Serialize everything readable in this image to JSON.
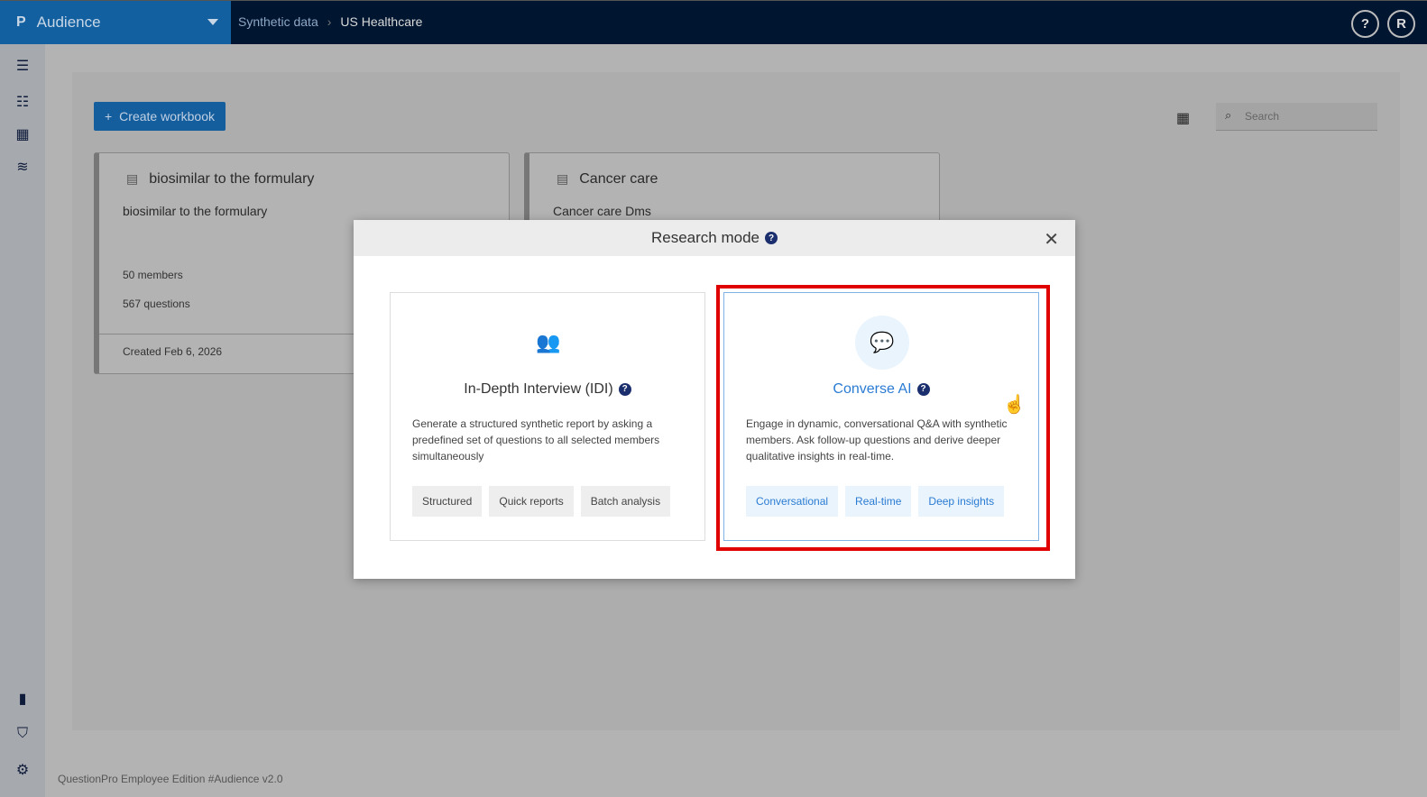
{
  "app": {
    "logo": "P",
    "name": "Audience"
  },
  "breadcrumb": [
    "Synthetic data",
    "US Healthcare"
  ],
  "header": {
    "help": "?",
    "avatar": "R"
  },
  "toolbar": {
    "create_label": "Create workbook",
    "search_placeholder": "Search"
  },
  "cards": [
    {
      "title": "biosimilar to the formulary",
      "description": "biosimilar to the formulary",
      "members": "50 members",
      "questions": "567 questions",
      "created": "Created Feb 6, 2026"
    },
    {
      "title": "Cancer care",
      "description": "Cancer care Dms"
    }
  ],
  "modal": {
    "title": "Research mode",
    "options": [
      {
        "title": "In-Depth Interview (IDI)",
        "description": "Generate a structured synthetic report by asking a predefined set of questions to all selected members simultaneously",
        "tags": [
          "Structured",
          "Quick reports",
          "Batch analysis"
        ],
        "icon": "users-icon"
      },
      {
        "title": "Converse AI",
        "description": "Engage in dynamic, conversational Q&A with synthetic members. Ask follow-up questions and derive deeper qualitative insights in real-time.",
        "tags": [
          "Conversational",
          "Real-time",
          "Deep insights"
        ],
        "icon": "chat-headset-icon",
        "selected": true
      }
    ]
  },
  "footer": "QuestionPro Employee Edition  #Audience v2.0",
  "colors": {
    "accent": "#2a7bd3",
    "highlight": "#e00000",
    "brand": "#12609f",
    "topbar": "#001530"
  }
}
